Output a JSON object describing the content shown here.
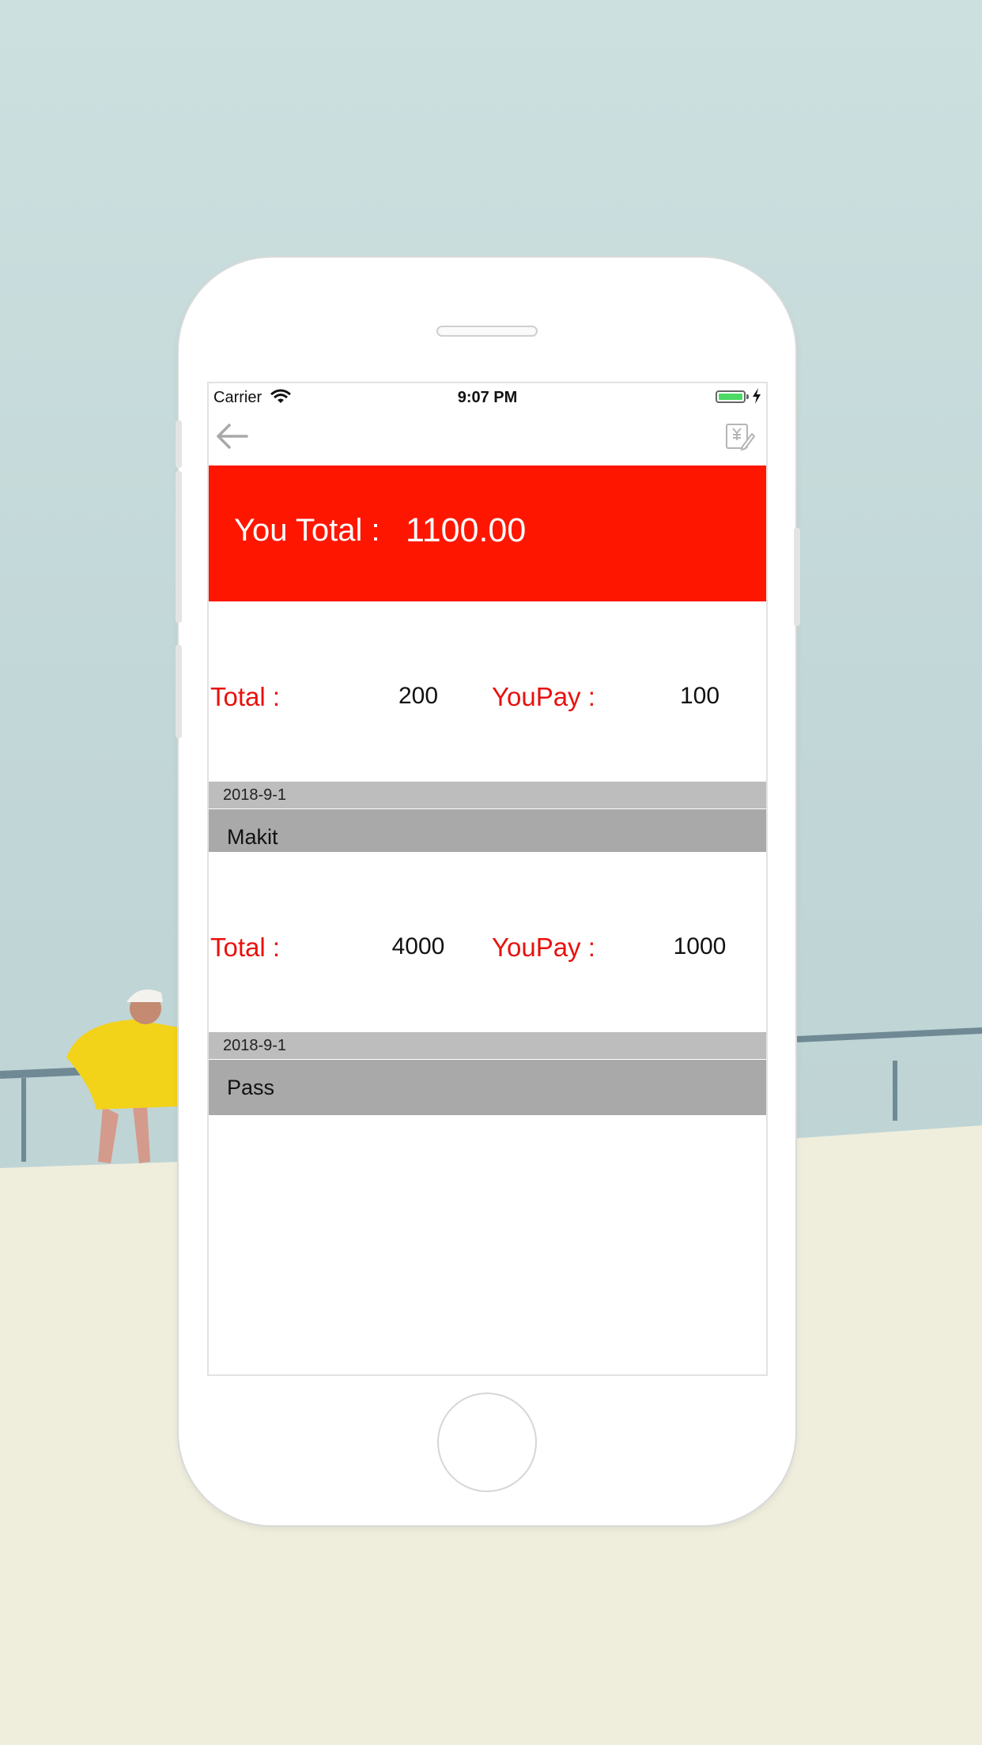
{
  "status_bar": {
    "carrier": "Carrier",
    "time": "9:07 PM",
    "battery_color": "#4cd964"
  },
  "nav": {
    "back_icon": "arrow-left-icon",
    "edit_icon": "yen-edit-icon"
  },
  "summary": {
    "label": "You Total :",
    "value": "1100.00",
    "color": "#ff1600"
  },
  "records": [
    {
      "total_label": "Total :",
      "total_value": "200",
      "pay_label": "YouPay :",
      "pay_value": "100",
      "date": "2018-9-1",
      "name": "Makit"
    },
    {
      "total_label": "Total :",
      "total_value": "4000",
      "pay_label": "YouPay :",
      "pay_value": "1000",
      "date": "2018-9-1",
      "name": "Pass"
    }
  ]
}
